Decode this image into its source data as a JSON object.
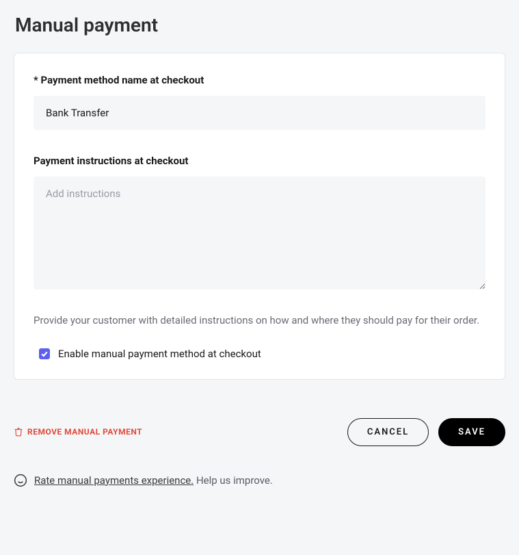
{
  "page": {
    "title": "Manual payment"
  },
  "form": {
    "name_label": "* Payment method name at checkout",
    "name_value": "Bank Transfer",
    "instructions_label": "Payment instructions at checkout",
    "instructions_placeholder": "Add instructions",
    "instructions_value": "",
    "help_text": "Provide your customer with detailed instructions on how and where they should pay for their order.",
    "enable_label": "Enable manual payment method at checkout",
    "enable_checked": true
  },
  "actions": {
    "remove_label": "Remove manual payment",
    "cancel_label": "Cancel",
    "save_label": "Save"
  },
  "feedback": {
    "link_text": "Rate manual payments experience.",
    "tail_text": " Help us improve."
  }
}
